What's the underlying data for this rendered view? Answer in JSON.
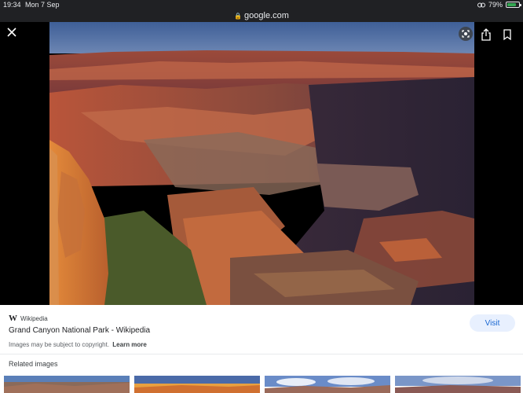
{
  "status": {
    "time": "19:34",
    "date": "Mon 7 Sep",
    "battery": "79%",
    "battery_level": 0.79
  },
  "browser": {
    "url": "google.com"
  },
  "viewer": {
    "icons": {
      "close": "close-icon",
      "lens": "lens-icon",
      "share": "share-icon",
      "bookmark": "bookmark-icon"
    }
  },
  "result": {
    "source_logo": "W",
    "source_name": "Wikipedia",
    "title": "Grand Canyon National Park - Wikipedia",
    "copyright": "Images may be subject to copyright.",
    "learn_more": "Learn more",
    "visit_label": "Visit",
    "related_label": "Related images"
  },
  "colors": {
    "accent": "#1967d2",
    "visit_bg": "#e8f0fe",
    "battery": "#34a853"
  }
}
